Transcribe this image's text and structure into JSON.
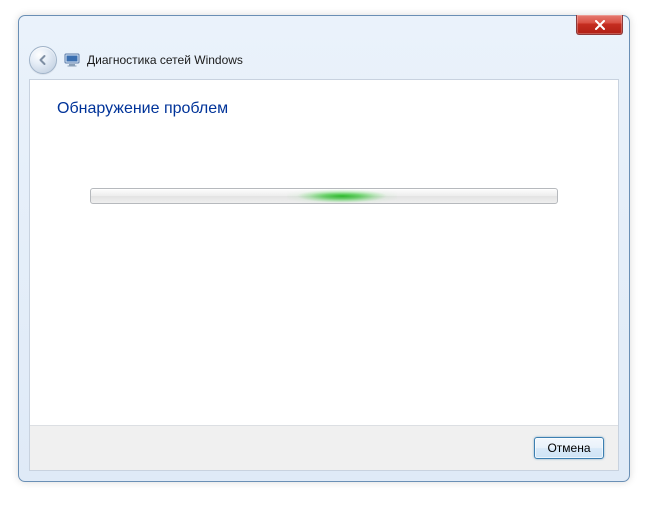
{
  "window": {
    "title": "Диагностика сетей Windows"
  },
  "content": {
    "heading": "Обнаружение проблем"
  },
  "footer": {
    "cancel_label": "Отмена"
  }
}
